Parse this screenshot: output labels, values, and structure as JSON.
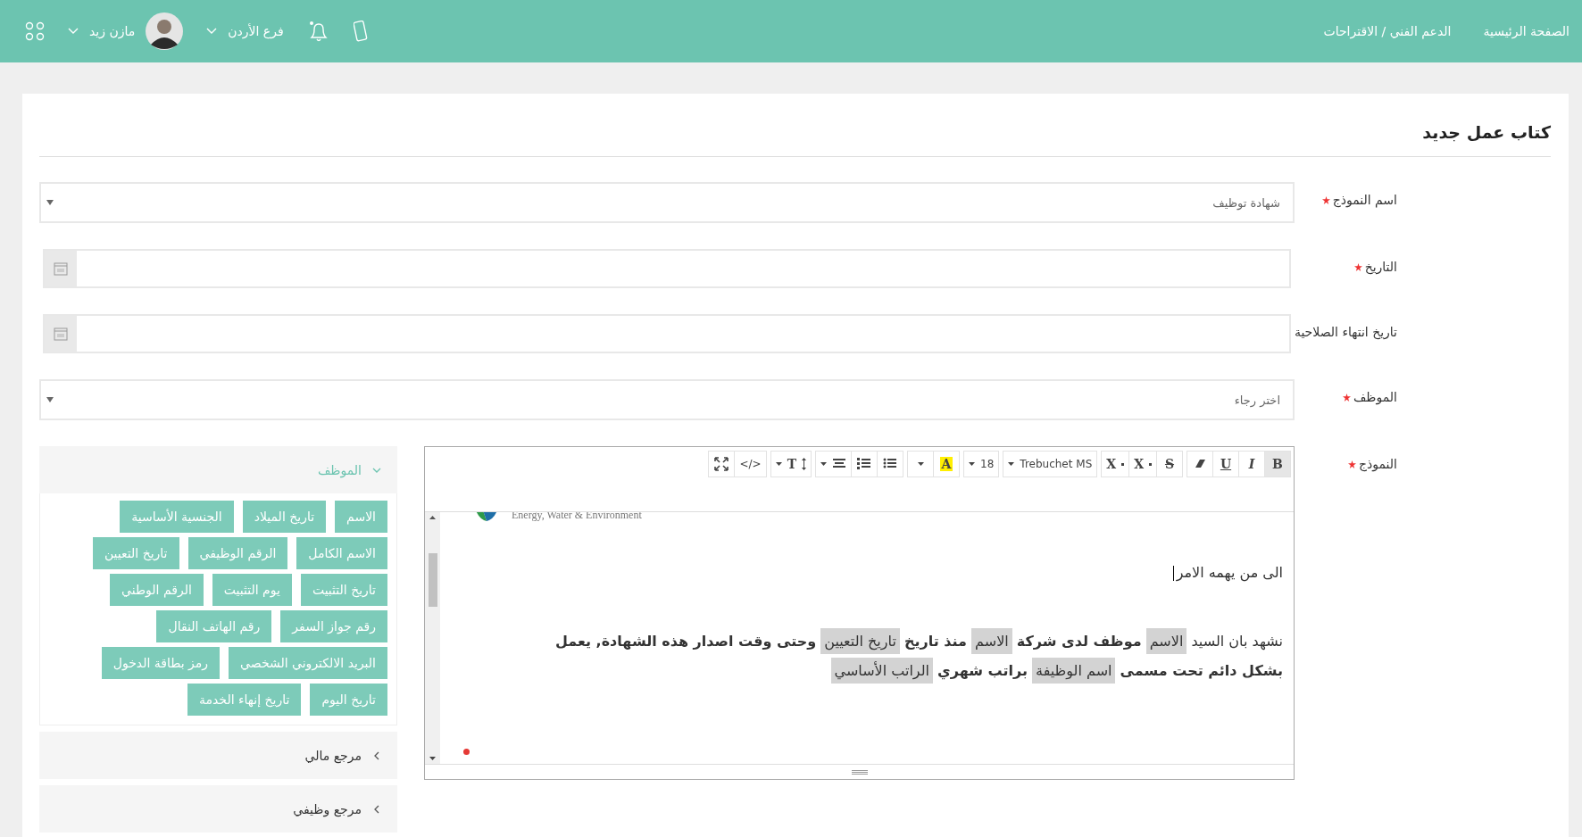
{
  "header": {
    "nav_links": [
      {
        "label": "الصفحة الرئيسية"
      },
      {
        "label": "الدعم الفني / الاقتراحات"
      }
    ],
    "branch": "فرع الأردن",
    "user": "مازن زيد"
  },
  "page_title": "كتاب عمل جديد",
  "fields": [
    {
      "label": "اسم النموذج",
      "required": true,
      "kind": "select",
      "value": "شهادة توظيف"
    },
    {
      "label": "التاريخ",
      "required": true,
      "kind": "date"
    },
    {
      "label": "تاريخ انتهاء الصلاحية",
      "kind": "date"
    },
    {
      "label": "الموظف",
      "required": true,
      "kind": "select",
      "placeholder": "اختر رجاء"
    }
  ],
  "template_field": {
    "label": "النموذج",
    "required": true
  },
  "editor": {
    "toolbar": [
      [
        {
          "kind": "bold",
          "label": "B",
          "selected": true
        },
        {
          "kind": "italic",
          "label": "I",
          "selected": false
        },
        {
          "kind": "underline",
          "label": "U",
          "selected": false
        },
        {
          "kind": "eraser",
          "selected": false
        }
      ],
      [
        {
          "kind": "strike",
          "label": "S",
          "selected": false
        },
        {
          "kind": "superscript",
          "label": "X",
          "selected": false
        },
        {
          "kind": "subscript",
          "label": "X",
          "selected": false
        }
      ],
      [
        {
          "kind": "dropdown",
          "label": "Trebuchet MS",
          "selected": false
        }
      ],
      [
        {
          "kind": "dropdown",
          "label": "18",
          "selected": false
        }
      ],
      [
        {
          "kind": "color",
          "label": "A",
          "selected": false
        },
        {
          "kind": "caret",
          "selected": false
        }
      ],
      [
        {
          "kind": "ul",
          "selected": false
        },
        {
          "kind": "ol",
          "selected": false
        },
        {
          "kind": "align",
          "selected": false
        }
      ],
      [
        {
          "kind": "height",
          "label": "T",
          "selected": false
        }
      ],
      [
        {
          "kind": "code",
          "label": "</>",
          "selected": false
        },
        {
          "kind": "fullscreen",
          "selected": false
        }
      ]
    ],
    "logo_caption": "Energy, Water & Environment",
    "paragraphs": [
      [
        {
          "kind": "plain",
          "text": "الى من يهمه الامر"
        }
      ],
      [
        {
          "kind": "plain",
          "text": "نشهد بان السيد"
        },
        {
          "kind": "field",
          "text": "الاسم"
        },
        {
          "kind": "bold",
          "text": "موظف لدى شركة"
        },
        {
          "kind": "field",
          "text": "الاسم"
        },
        {
          "kind": "bold",
          "text": "منذ تاريخ"
        },
        {
          "kind": "field",
          "text": "تاريخ التعيين"
        },
        {
          "kind": "bold",
          "text": "وحتى وقت اصدار هذه الشهادة, يعمل"
        },
        {
          "kind": "bold",
          "text": "بشكل دائم تحت مسمى"
        },
        {
          "kind": "field",
          "text": "اسم الوظيفة"
        },
        {
          "kind": "bold",
          "text": "براتب شهري"
        },
        {
          "kind": "field",
          "text": "الراتب الأساسي"
        }
      ]
    ]
  },
  "variables_panel": {
    "sections": [
      {
        "title": "الموظف",
        "expanded": true,
        "tag_rows": [
          [
            "الاسم",
            "تاريخ الميلاد",
            "الجنسية الأساسية"
          ],
          [
            "الاسم الكامل",
            "الرقم الوظيفي",
            "تاريخ التعيين"
          ],
          [
            "تاريخ التثبيت",
            "يوم التثبيت",
            "الرقم الوطني"
          ],
          [
            "رقم جواز السفر",
            "رقم الهاتف النقال"
          ],
          [
            "البريد الالكتروني الشخصي",
            "رمز بطاقة الدخول"
          ],
          [
            "تاريخ اليوم",
            "تاريخ إنهاء الخدمة"
          ]
        ]
      },
      {
        "title": "مرجع مالي",
        "expanded": false
      },
      {
        "title": "مرجع وظيفي",
        "expanded": false
      }
    ]
  }
}
